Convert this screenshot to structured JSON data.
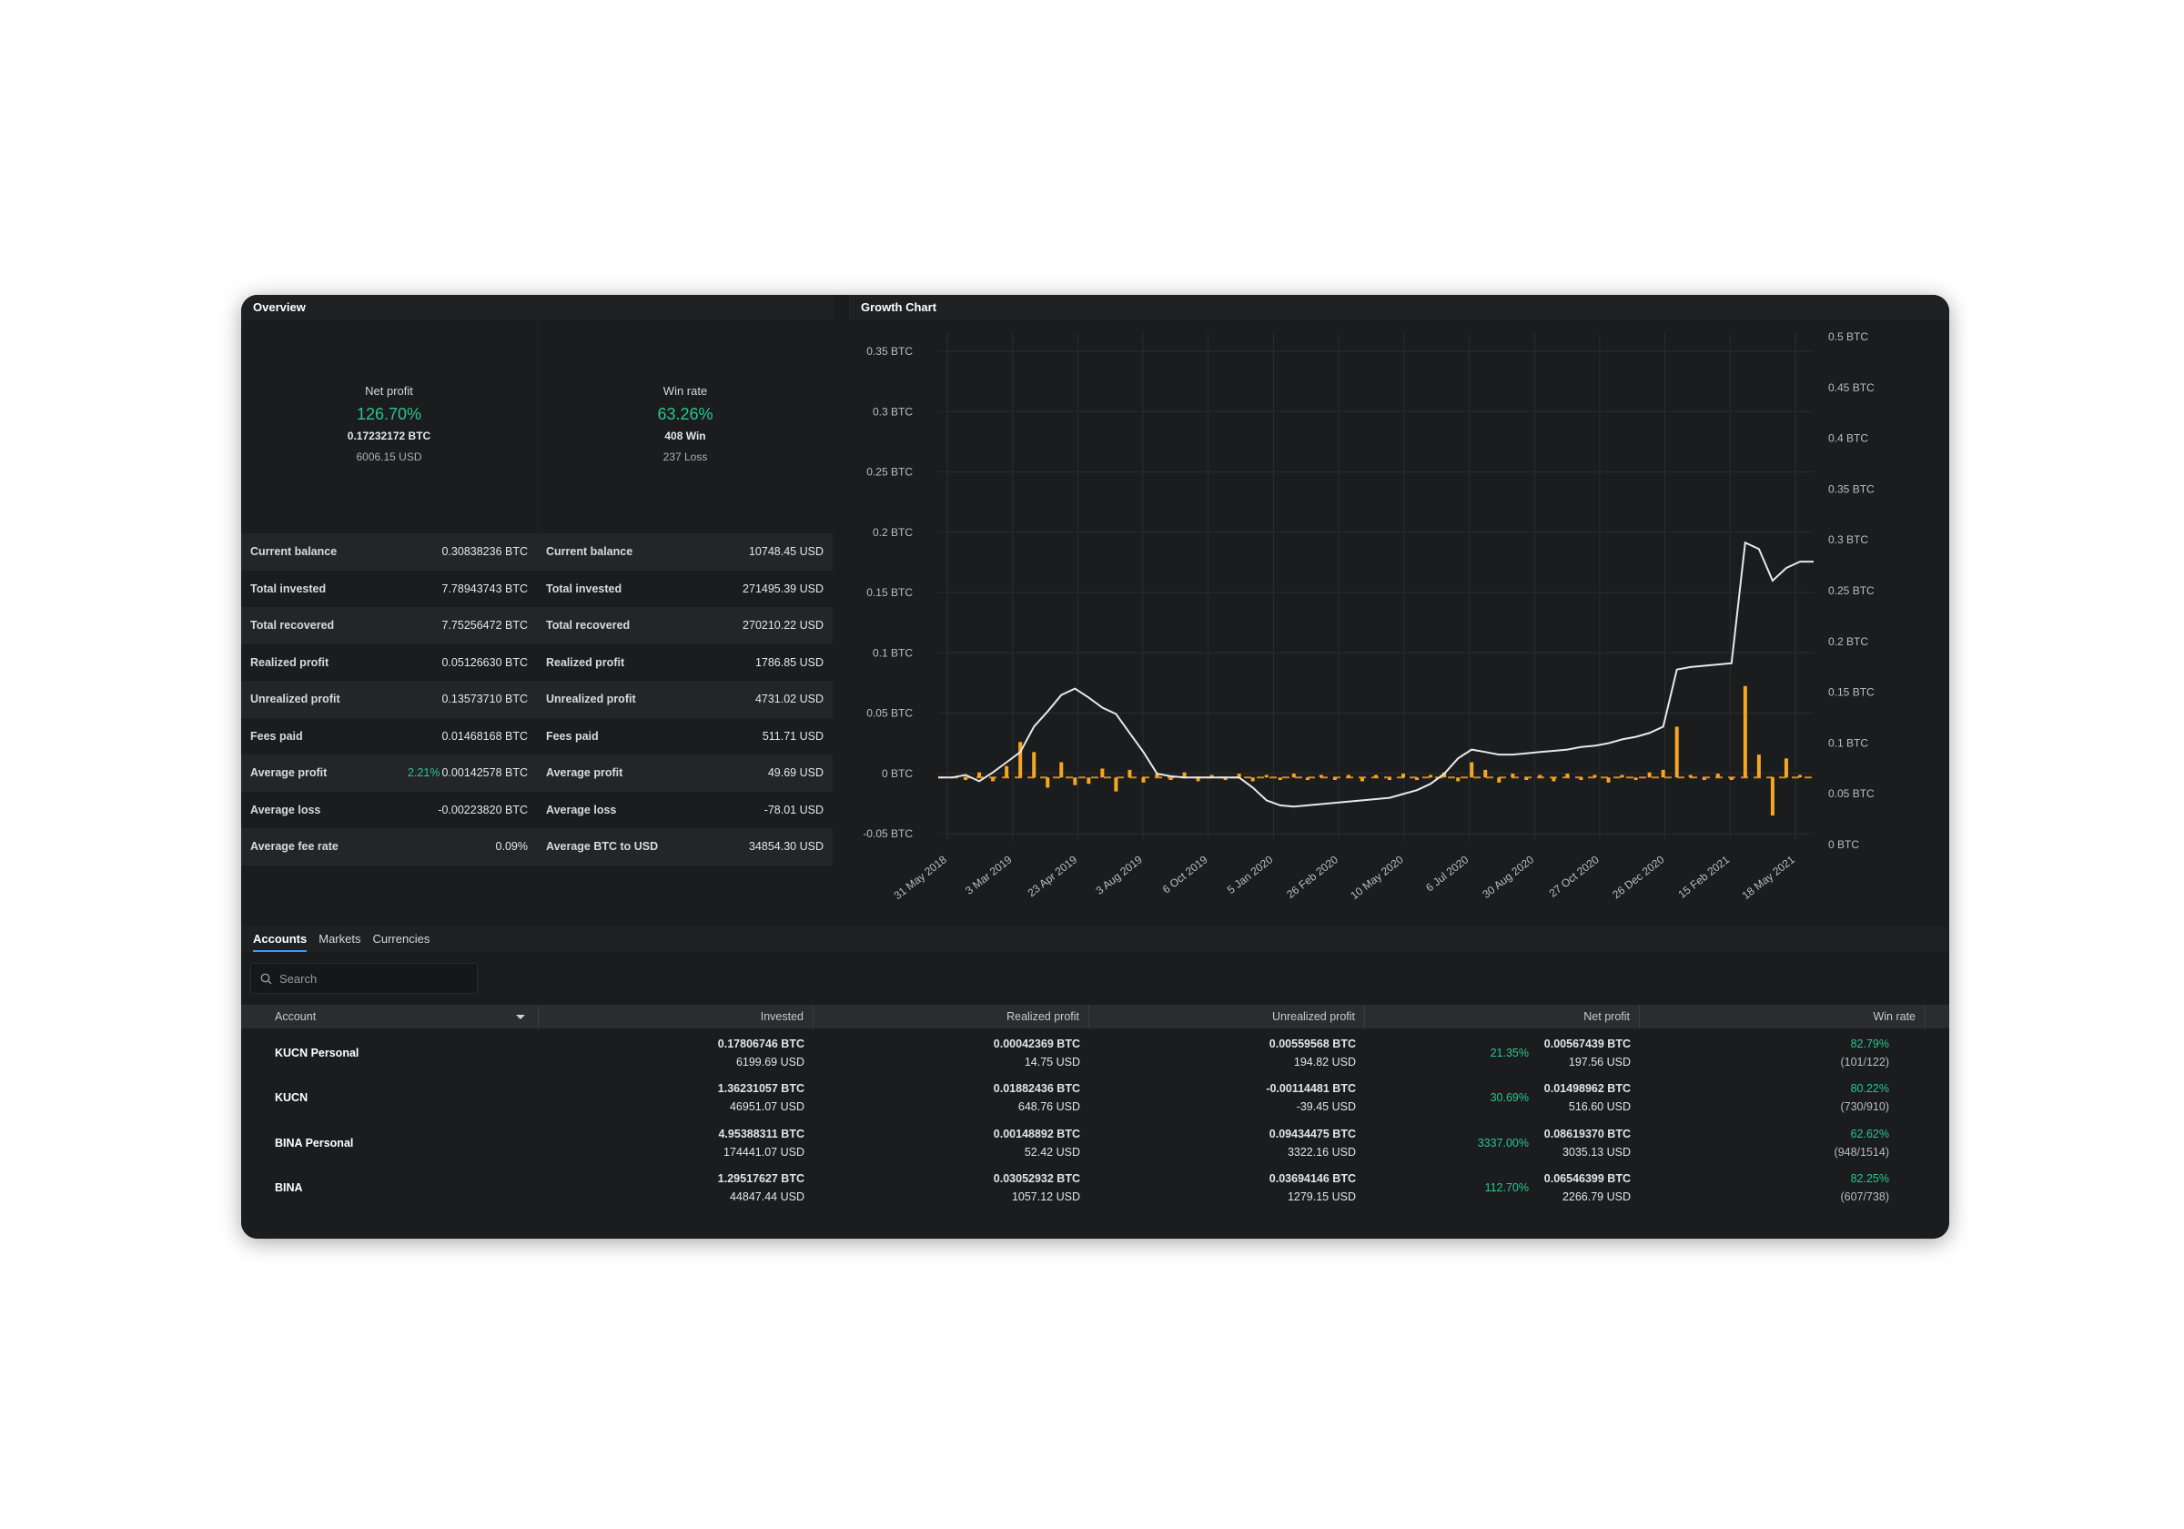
{
  "overview": {
    "title": "Overview",
    "net_profit": {
      "label": "Net profit",
      "pct": "126.70%",
      "btc": "0.17232172 BTC",
      "usd": "6006.15 USD"
    },
    "win_rate": {
      "label": "Win rate",
      "pct": "63.26%",
      "wins": "408 Win",
      "losses": "237 Loss"
    },
    "btc_stats": [
      {
        "key": "Current balance",
        "value": "0.30838236 BTC"
      },
      {
        "key": "Total invested",
        "value": "7.78943743 BTC"
      },
      {
        "key": "Total recovered",
        "value": "7.75256472 BTC"
      },
      {
        "key": "Realized profit",
        "value": "0.05126630 BTC"
      },
      {
        "key": "Unrealized profit",
        "value": "0.13573710 BTC"
      },
      {
        "key": "Fees paid",
        "value": "0.01468168 BTC"
      },
      {
        "key": "Average profit",
        "pct": "2.21%",
        "value": "0.00142578 BTC"
      },
      {
        "key": "Average loss",
        "value": "-0.00223820 BTC"
      },
      {
        "key": "Average fee rate",
        "value": "0.09%"
      }
    ],
    "usd_stats": [
      {
        "key": "Current balance",
        "value": "10748.45 USD"
      },
      {
        "key": "Total invested",
        "value": "271495.39 USD"
      },
      {
        "key": "Total recovered",
        "value": "270210.22 USD"
      },
      {
        "key": "Realized profit",
        "value": "1786.85 USD"
      },
      {
        "key": "Unrealized profit",
        "value": "4731.02 USD"
      },
      {
        "key": "Fees paid",
        "value": "511.71 USD"
      },
      {
        "key": "Average profit",
        "value": "49.69 USD"
      },
      {
        "key": "Average loss",
        "value": "-78.01 USD"
      },
      {
        "key": "Average BTC to USD",
        "value": "34854.30 USD"
      }
    ]
  },
  "growth": {
    "title": "Growth Chart",
    "colors": {
      "line": "#e8e8e8",
      "bars": "#f5a623",
      "volume": "#3a3b3e",
      "grid": "#2b2c2f",
      "axis_text": "#bdbdbd"
    }
  },
  "chart_data": {
    "type": "line",
    "x_tick_labels": [
      "31 May 2018",
      "3 Mar 2019",
      "23 Apr 2019",
      "3 Aug 2019",
      "6 Oct 2019",
      "5 Jan 2020",
      "26 Feb 2020",
      "10 May 2020",
      "6 Jul 2020",
      "30 Aug 2020",
      "27 Oct 2020",
      "26 Dec 2020",
      "15 Feb 2021",
      "18 May 2021"
    ],
    "y_left_ticks": [
      "0.35 BTC",
      "0.3 BTC",
      "0.25 BTC",
      "0.2 BTC",
      "0.15 BTC",
      "0.1 BTC",
      "0.05 BTC",
      "0 BTC",
      "-0.05 BTC"
    ],
    "y_right_ticks": [
      "0.5 BTC",
      "0.45 BTC",
      "0.4 BTC",
      "0.35 BTC",
      "0.3 BTC",
      "0.25 BTC",
      "0.2 BTC",
      "0.15 BTC",
      "0.1 BTC",
      "0.05 BTC",
      "0 BTC"
    ],
    "y_left_lim": [
      -0.05,
      0.35
    ],
    "y_right_lim": [
      0,
      0.5
    ],
    "series": [
      {
        "name": "",
        "values": [
          0,
          0,
          0.002,
          -0.003,
          0.004,
          0.012,
          0.02,
          0.04,
          0.052,
          0.065,
          0.07,
          0.063,
          0.055,
          0.05,
          0.035,
          0.02,
          0.003,
          0.001,
          0,
          0,
          0,
          0,
          0,
          -0.008,
          -0.018,
          -0.022,
          -0.023,
          -0.022,
          -0.021,
          -0.02,
          -0.019,
          -0.018,
          -0.017,
          -0.016,
          -0.013,
          -0.01,
          -0.005,
          0.003,
          0.015,
          0.022,
          0.02,
          0.018,
          0.018,
          0.019,
          0.02,
          0.021,
          0.022,
          0.024,
          0.025,
          0.027,
          0.03,
          0.032,
          0.035,
          0.04,
          0.085,
          0.087,
          0.088,
          0.089,
          0.09,
          0.185,
          0.18,
          0.155,
          0.165,
          0.17,
          0.17
        ]
      }
    ],
    "bars": [
      0,
      0,
      -0.002,
      0.004,
      -0.003,
      0.009,
      0.028,
      0.02,
      -0.008,
      0.012,
      -0.006,
      -0.005,
      0.007,
      -0.011,
      0.006,
      -0.004,
      0.003,
      -0.002,
      0.004,
      -0.003,
      0.002,
      -0.002,
      0.003,
      -0.003,
      0.002,
      -0.002,
      0.003,
      -0.002,
      0.002,
      -0.002,
      0.002,
      -0.003,
      0.002,
      -0.002,
      0.003,
      -0.002,
      0.002,
      0.004,
      -0.003,
      0.012,
      0.006,
      -0.004,
      0.003,
      -0.002,
      0.002,
      -0.003,
      0.003,
      -0.002,
      0.002,
      -0.004,
      0.002,
      -0.002,
      0.004,
      0.006,
      0.04,
      0.002,
      -0.002,
      0.003,
      -0.002,
      0.072,
      0.018,
      -0.03,
      0.015,
      0.002,
      0
    ]
  },
  "tabs": [
    {
      "label": "Accounts",
      "active": true
    },
    {
      "label": "Markets",
      "active": false
    },
    {
      "label": "Currencies",
      "active": false
    }
  ],
  "search": {
    "placeholder": "Search"
  },
  "table": {
    "headers": [
      "Account",
      "Invested",
      "Realized profit",
      "Unrealized profit",
      "Net profit",
      "Win rate"
    ],
    "rows": [
      {
        "account": "KUCN Personal",
        "invested_btc": "0.17806746 BTC",
        "invested_usd": "6199.69 USD",
        "realized_btc": "0.00042369 BTC",
        "realized_usd": "14.75 USD",
        "unrealized_btc": "0.00559568 BTC",
        "unrealized_usd": "194.82 USD",
        "net_pct": "21.35%",
        "net_btc": "0.00567439 BTC",
        "net_usd": "197.56 USD",
        "win_pct": "82.79%",
        "win_count": "(101/122)"
      },
      {
        "account": "KUCN",
        "invested_btc": "1.36231057 BTC",
        "invested_usd": "46951.07 USD",
        "realized_btc": "0.01882436 BTC",
        "realized_usd": "648.76 USD",
        "unrealized_btc": "-0.00114481 BTC",
        "unrealized_usd": "-39.45 USD",
        "net_pct": "30.69%",
        "net_btc": "0.01498962 BTC",
        "net_usd": "516.60 USD",
        "win_pct": "80.22%",
        "win_count": "(730/910)"
      },
      {
        "account": "BINA Personal",
        "invested_btc": "4.95388311 BTC",
        "invested_usd": "174441.07 USD",
        "realized_btc": "0.00148892 BTC",
        "realized_usd": "52.42 USD",
        "unrealized_btc": "0.09434475 BTC",
        "unrealized_usd": "3322.16 USD",
        "net_pct": "3337.00%",
        "net_btc": "0.08619370 BTC",
        "net_usd": "3035.13 USD",
        "win_pct": "62.62%",
        "win_count": "(948/1514)"
      },
      {
        "account": "BINA",
        "invested_btc": "1.29517627 BTC",
        "invested_usd": "44847.44 USD",
        "realized_btc": "0.03052932 BTC",
        "realized_usd": "1057.12 USD",
        "unrealized_btc": "0.03694146 BTC",
        "unrealized_usd": "1279.15 USD",
        "net_pct": "112.70%",
        "net_btc": "0.06546399 BTC",
        "net_usd": "2266.79 USD",
        "win_pct": "82.25%",
        "win_count": "(607/738)"
      }
    ]
  }
}
